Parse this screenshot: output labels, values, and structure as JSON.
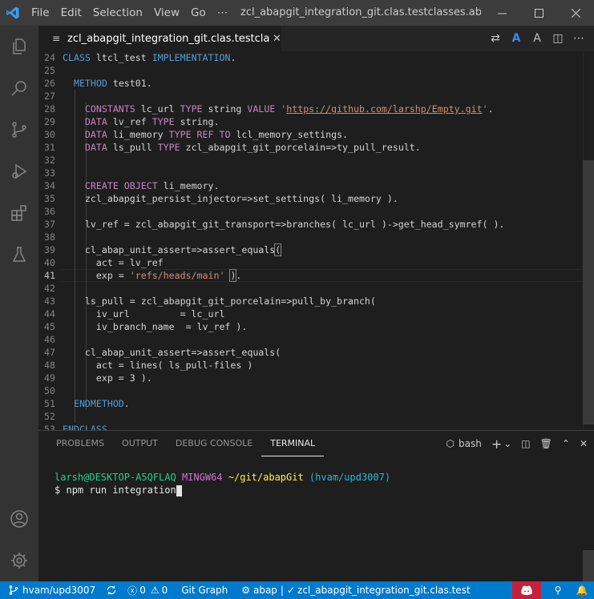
{
  "titlebar": {
    "menu": [
      "File",
      "Edit",
      "Selection",
      "View",
      "Go",
      "⋯"
    ],
    "title": "zcl_abapgit_integration_git.clas.testclasses.abap - ab..."
  },
  "tab": {
    "label": "zcl_abapgit_integration_git.clas.testclasses.abap"
  },
  "editor": {
    "current_line": 41,
    "lines": [
      {
        "n": "24",
        "html": "<span class=\"k\">CLASS</span> <span class=\"d\">ltcl_test</span> <span class=\"k\">IMPLEMENTATION</span><span class=\"d\">.</span>"
      },
      {
        "n": "25",
        "html": ""
      },
      {
        "n": "26",
        "html": "  <span class=\"k\">METHOD</span> <span class=\"d\">test01.</span>"
      },
      {
        "n": "27",
        "html": ""
      },
      {
        "n": "28",
        "html": "    <span class=\"kw\">CONSTANTS</span> <span class=\"d\">lc_url</span> <span class=\"kw\">TYPE</span> <span class=\"d\">string</span> <span class=\"kw\">VALUE</span> <span class=\"s\">'</span><span class=\"sl\">https://github.com/larshp/Empty.git</span><span class=\"s\">'</span><span class=\"d\">.</span>"
      },
      {
        "n": "29",
        "html": "    <span class=\"kw\">DATA</span> <span class=\"d\">lv_ref</span> <span class=\"kw\">TYPE</span> <span class=\"d\">string.</span>"
      },
      {
        "n": "30",
        "html": "    <span class=\"kw\">DATA</span> <span class=\"d\">li_memory</span> <span class=\"kw\">TYPE</span> <span class=\"kw\">REF</span> <span class=\"kw\">TO</span> <span class=\"d\">lcl_memory_settings.</span>"
      },
      {
        "n": "31",
        "html": "    <span class=\"kw\">DATA</span> <span class=\"d\">ls_pull</span> <span class=\"kw\">TYPE</span> <span class=\"d\">zcl_abapgit_git_porcelain=>ty_pull_result.</span>"
      },
      {
        "n": "32",
        "html": ""
      },
      {
        "n": "33",
        "html": ""
      },
      {
        "n": "34",
        "html": "    <span class=\"kw\">CREATE</span> <span class=\"kw\">OBJECT</span> <span class=\"d\">li_memory.</span>"
      },
      {
        "n": "35",
        "html": "    <span class=\"d\">zcl_abapgit_persist_injector=>set_settings( li_memory ).</span>"
      },
      {
        "n": "36",
        "html": ""
      },
      {
        "n": "37",
        "html": "    <span class=\"d\">lv_ref = zcl_abapgit_git_transport=>branches( lc_url )->get_head_symref( ).</span>"
      },
      {
        "n": "38",
        "html": ""
      },
      {
        "n": "39",
        "html": "    <span class=\"d\">cl_abap_unit_assert=>assert_equals</span><span class=\"d br\">(</span>"
      },
      {
        "n": "40",
        "html": "      <span class=\"d\">act = lv_ref</span>"
      },
      {
        "n": "41",
        "html": "      <span class=\"d\">exp = </span><span class=\"s\">'refs/heads/main'</span><span class=\"d\"> </span><span class=\"d br\">)</span><span class=\"d\">.</span>"
      },
      {
        "n": "42",
        "html": "    "
      },
      {
        "n": "43",
        "html": "    <span class=\"d\">ls_pull = zcl_abapgit_git_porcelain=>pull_by_branch(</span>"
      },
      {
        "n": "44",
        "html": "      <span class=\"d\">iv_url         = lc_url</span>"
      },
      {
        "n": "45",
        "html": "      <span class=\"d\">iv_branch_name  = lv_ref ).</span>"
      },
      {
        "n": "46",
        "html": ""
      },
      {
        "n": "47",
        "html": "    <span class=\"d\">cl_abap_unit_assert=>assert_equals(</span>"
      },
      {
        "n": "48",
        "html": "      <span class=\"d\">act = lines( ls_pull-files )</span>"
      },
      {
        "n": "49",
        "html": "      <span class=\"d\">exp = 3 ).</span>"
      },
      {
        "n": "50",
        "html": ""
      },
      {
        "n": "51",
        "html": "  <span class=\"k\">ENDMETHOD</span><span class=\"d\">.</span>"
      },
      {
        "n": "52",
        "html": ""
      },
      {
        "n": "53",
        "html": "<span class=\"k\">ENDCLASS</span><span class=\"d\">.</span>"
      }
    ]
  },
  "panel": {
    "tabs": [
      "PROBLEMS",
      "OUTPUT",
      "DEBUG CONSOLE",
      "TERMINAL"
    ],
    "active_tab": "TERMINAL",
    "shell": "bash",
    "terminal": {
      "user_host": "larsh@DESKTOP-A5QFLAQ",
      "env": "MINGW64",
      "path": "~/git/abapGit",
      "branch": "(hvam/upd3007)",
      "prompt": "$",
      "command": "npm run integration"
    }
  },
  "statusbar": {
    "branch": "hvam/upd3007",
    "errors": "0",
    "warnings": "0",
    "git_graph": "Git Graph",
    "language": "abap",
    "file_check": "zcl_abapgit_integration_git.clas.testclasse"
  },
  "colors": {
    "statusbar_bg": "#007acc",
    "activity_bg": "#333333",
    "titlebar_bg": "#3c3c3c",
    "editor_bg": "#1e1e1e",
    "remote_badge": "#c7203b"
  }
}
